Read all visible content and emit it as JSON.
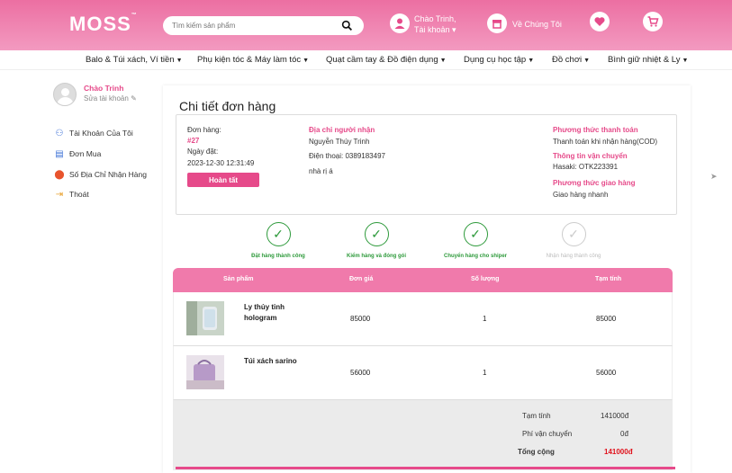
{
  "header": {
    "logo": "MOSS",
    "logo_mark": "™",
    "search_placeholder": "Tìm kiếm sản phẩm",
    "greeting_line1": "Chào Trinh,",
    "greeting_line2": "Tài khoản ▾",
    "about": "Về Chúng Tôi"
  },
  "nav": {
    "items": [
      {
        "label": "Balo & Túi xách, Ví tiền"
      },
      {
        "label": "Phụ kiện tóc & Máy làm tóc"
      },
      {
        "label": "Quạt cầm tay & Đồ điện dụng"
      },
      {
        "label": "Dụng cụ học tập"
      },
      {
        "label": "Đồ chơi"
      },
      {
        "label": "Bình giữ nhiệt & Ly"
      }
    ]
  },
  "sidebar": {
    "greeting": "Chào Trinh",
    "edit": "Sửa tài khoản",
    "items": [
      {
        "label": "Tài Khoản Của Tôi",
        "icon": "user-settings-icon"
      },
      {
        "label": "Đơn Mua",
        "icon": "list-icon"
      },
      {
        "label": "Số Địa Chỉ Nhận Hàng",
        "icon": "location-icon"
      },
      {
        "label": "Thoát",
        "icon": "logout-icon"
      }
    ]
  },
  "order": {
    "title": "Chi tiết đơn hàng",
    "order_label": "Đơn hàng:",
    "order_id": "#27",
    "date_label": "Ngày đặt:",
    "date": "2023-12-30 12:31:49",
    "status_button": "Hoàn tất",
    "address_heading": "Địa chỉ người nhận",
    "recipient": "Nguyễn Thúy Trinh",
    "phone": "Điện thoại: 0389183497",
    "address": "nhà rị á",
    "payment_heading": "Phương thức thanh toán",
    "payment": "Thanh toán khi nhận hàng(COD)",
    "shipping_info_heading": "Thông tin vận chuyển",
    "shipping_info": "Hasaki: OTK223391",
    "delivery_heading": "Phương thức giao hàng",
    "delivery": "Giao hàng nhanh"
  },
  "steps": [
    {
      "label": "Đặt hàng thành công",
      "done": true
    },
    {
      "label": "Kiểm hàng và đóng gói",
      "done": true
    },
    {
      "label": "Chuyển hàng cho shiper",
      "done": true
    },
    {
      "label": "Nhận hàng thành công",
      "done": false
    }
  ],
  "step_check": "✓",
  "table": {
    "headers": [
      "Sản phẩm",
      "Đơn giá",
      "Số lượng",
      "Tạm tính"
    ],
    "rows": [
      {
        "name": "Ly thủy tinh hologram",
        "price": "85000",
        "qty": "1",
        "subtotal": "85000"
      },
      {
        "name": "Túi xách sarino",
        "price": "56000",
        "qty": "1",
        "subtotal": "56000"
      }
    ],
    "summary": {
      "subtotal_label": "Tạm tính",
      "subtotal": "141000đ",
      "shipping_label": "Phí vận chuyển",
      "shipping": "0đ",
      "total_label": "Tổng cộng",
      "total": "141000đ"
    }
  },
  "colors": {
    "brand": "#e64a8a",
    "success": "#2e9a3b"
  }
}
